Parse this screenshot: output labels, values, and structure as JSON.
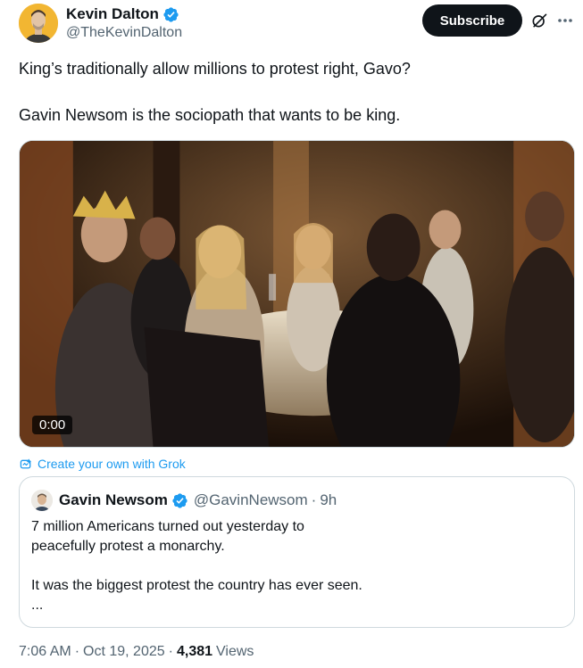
{
  "author": {
    "display_name": "Kevin Dalton",
    "handle": "@TheKevinDalton",
    "avatar_icon": "profile-photo",
    "verified_icon": "verified-badge-icon",
    "verified_color": "#1d9bf0"
  },
  "header": {
    "subscribe_label": "Subscribe",
    "grok_icon": "grok-icon",
    "more_icon": "more-icon"
  },
  "tweet": {
    "lines": [
      "King’s traditionally allow millions to protest right, Gavo?",
      "Gavin Newsom is the sociopath that wants to be king."
    ]
  },
  "media": {
    "type": "video",
    "timestamp": "0:00"
  },
  "grok_link": {
    "label": "Create your own with Grok",
    "color": "#1d9bf0"
  },
  "quote": {
    "display_name": "Gavin Newsom",
    "handle": "@GavinNewsom",
    "separator": "·",
    "time": "9h",
    "lines": [
      "7 million Americans turned out yesterday to",
      "peacefully protest a monarchy.",
      "It was the biggest protest the country has ever seen.",
      "..."
    ]
  },
  "footer": {
    "time": "7:06 AM",
    "date": "Oct 19, 2025",
    "separator": "·",
    "views_count": "4,381",
    "views_label": "Views"
  }
}
